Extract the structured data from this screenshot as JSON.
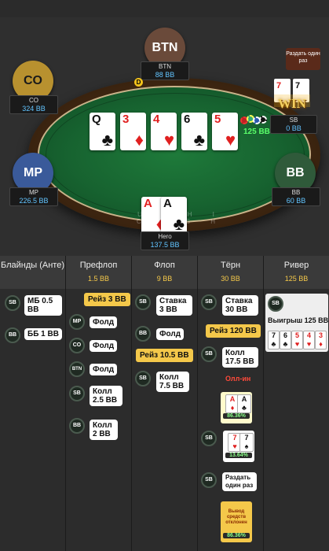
{
  "table": {
    "rail_text": "U S H I C A S H",
    "tip_button": "Раздать один раз",
    "dealer_marker": "D",
    "pot": "125 BB",
    "win_text": "WIN",
    "players": {
      "btn": {
        "avatar": "BTN",
        "name": "BTN",
        "stack": "88 BB"
      },
      "co": {
        "avatar": "CO",
        "name": "CO",
        "stack": "324 BB"
      },
      "sb": {
        "name": "SB",
        "stack": "0 BB"
      },
      "mp": {
        "avatar": "MP",
        "name": "MP",
        "stack": "226.5 BB"
      },
      "bb": {
        "avatar": "BB",
        "name": "BB",
        "stack": "60 BB"
      },
      "hero": {
        "name": "Hero",
        "stack": "137.5 BB"
      }
    },
    "board": [
      {
        "rank": "Q",
        "suit": "♣",
        "color": "black"
      },
      {
        "rank": "3",
        "suit": "♦",
        "color": "red"
      },
      {
        "rank": "4",
        "suit": "♥",
        "color": "red"
      },
      {
        "rank": "6",
        "suit": "♣",
        "color": "black"
      },
      {
        "rank": "5",
        "suit": "♥",
        "color": "red"
      }
    ],
    "hero_cards": [
      {
        "rank": "A",
        "suit": "♦",
        "color": "red"
      },
      {
        "rank": "A",
        "suit": "♣",
        "color": "black"
      }
    ],
    "sb_cards": [
      {
        "rank": "7",
        "suit": "♥",
        "color": "red"
      },
      {
        "rank": "7",
        "suit": "♠",
        "color": "black"
      }
    ]
  },
  "history": {
    "columns": [
      {
        "title": "Блайнды (Анте)",
        "value": ""
      },
      {
        "title": "Префлоп",
        "value": "1.5 BB"
      },
      {
        "title": "Флоп",
        "value": "9 BB"
      },
      {
        "title": "Тёрн",
        "value": "30 BB"
      },
      {
        "title": "Ривер",
        "value": "125 BB"
      }
    ],
    "blinds": {
      "sb_pos": "SB",
      "sb_text": "МБ 0.5 BB",
      "bb_pos": "BB",
      "bb_text": "ББ 1 BB"
    },
    "preflop": {
      "raise": "Рейз 3 BB",
      "mp_pos": "MP",
      "mp": "Фолд",
      "co_pos": "CO",
      "co": "Фолд",
      "btn_pos": "BTN",
      "btn": "Фолд",
      "sb_pos": "SB",
      "sb": "Колл 2.5 BB",
      "bb_pos": "BB",
      "bb": "Колл 2 BB"
    },
    "flop": {
      "sb_pos": "SB",
      "sb": "Ставка 3 BB",
      "bb_pos": "BB",
      "bb": "Фолд",
      "raise": "Рейз 10.5 BB",
      "sb2_pos": "SB",
      "sb2": "Колл 7.5 BB"
    },
    "turn": {
      "sb_pos": "SB",
      "sb": "Ставка 30 BB",
      "raise": "Рейз 120 BB",
      "sb2_pos": "SB",
      "sb2": "Колл 17.5 BB",
      "allin": "Олл-ин",
      "hero_equity": "86.36%",
      "sb3_pos": "SB",
      "sb_equity": "13.64%",
      "sb4_pos": "SB",
      "run_once": "Раздать один раз",
      "withdraw": "Вывод средств отклонен",
      "withdraw_pct": "86.36%"
    },
    "river": {
      "sb_pos": "SB",
      "win": "Выигрыш 125 BB",
      "cards": [
        {
          "rank": "7",
          "suit": "♣",
          "color": "black"
        },
        {
          "rank": "6",
          "suit": "♣",
          "color": "black"
        },
        {
          "rank": "5",
          "suit": "♥",
          "color": "red"
        },
        {
          "rank": "4",
          "suit": "♥",
          "color": "red"
        },
        {
          "rank": "3",
          "suit": "♦",
          "color": "red"
        }
      ]
    }
  }
}
